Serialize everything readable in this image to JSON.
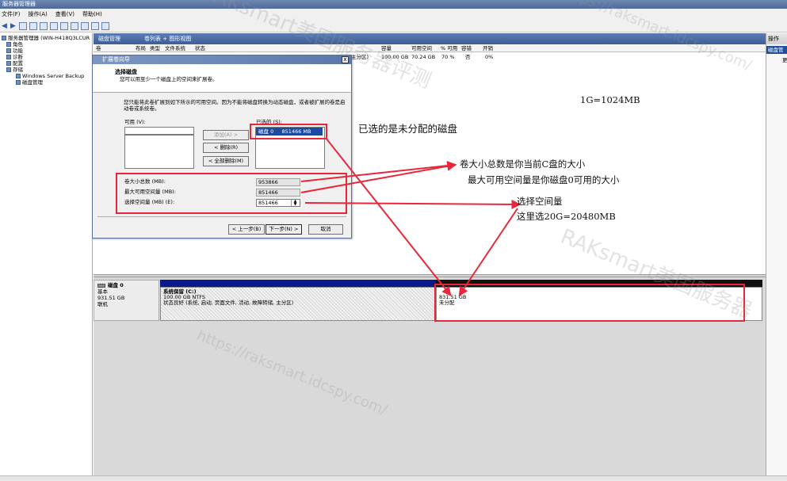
{
  "window": {
    "title": "服务器管理器"
  },
  "menu": [
    "文件(F)",
    "操作(A)",
    "查看(V)",
    "帮助(H)"
  ],
  "tree": {
    "items": [
      "服务器管理器 (WIN-H418Q3LCUR",
      "角色",
      "功能",
      "诊断",
      "配置",
      "存储",
      "Windows Server Backup",
      "磁盘管理"
    ]
  },
  "main": {
    "title": "磁盘管理",
    "view": "卷列表 + 图形视图",
    "columns": [
      "卷",
      "布局",
      "类型",
      "文件系统",
      "状态",
      "容量",
      "可用空间",
      "% 可用",
      "容错",
      "开销"
    ],
    "volume_row": {
      "status": "主分区)",
      "capacity": "100.00 GB",
      "free": "70.24 GB",
      "pct": "70 %",
      "fault": "否",
      "overhead": "0%"
    }
  },
  "actions": {
    "header": "操作",
    "item": "磁盘管",
    "more": "更"
  },
  "disk": {
    "name": "磁盘 0",
    "type": "基本",
    "size": "931.51 GB",
    "state": "联机",
    "partition_c": {
      "name": "系统保留  (C:)",
      "size_fs": "100.00 GB NTFS",
      "status": "状态良好 (系统, 启动, 页面文件, 活动, 故障转储, 主分区)"
    },
    "partition_u": {
      "size": "831.51 GB",
      "status": "未分配"
    }
  },
  "wizard": {
    "title": "扩展卷向导",
    "close": "x",
    "header_title": "选择磁盘",
    "header_sub": "您可以用至少一个磁盘上的空间来扩展卷。",
    "desc": "您只能将此卷扩展到如下所示的可用空间。因为不能将磁盘转换为动态磁盘，或者被扩展的卷是启动卷或系统卷。",
    "available_label": "可用 (V):",
    "selected_label": "已选的 (S):",
    "selected_item": "磁盘 0     851466 MB",
    "add_button": "添加(A) >",
    "remove_button": "< 删除(R)",
    "remove_all_button": "< 全部删除(M)",
    "total_label": "卷大小总数 (MB):",
    "total_value": "953866",
    "max_label": "最大可用空间量 (MB):",
    "max_value": "851466",
    "select_label": "选择空间量 (MB) (E):",
    "select_value": "851466",
    "back_button": "< 上一步(B)",
    "next_button": "下一步(N) >",
    "cancel_button": "取消"
  },
  "annotations": {
    "unit": "1G=1024MB",
    "selected_unallocated": "已选的是未分配的磁盘",
    "total_is_c": "卷大小总数是你当前C盘的大小",
    "max_is_free": "最大可用空间量是你磁盘0可用的大小",
    "choose_amount": "选择空间量",
    "example": "这里选20G=20480MB"
  },
  "watermarks": [
    "RAKsmart美国服务器评测",
    "https://raksmart.idcspy.com/",
    "RAKsmart美国服务器",
    "https://raksmart.idcspy.com/"
  ],
  "colors": {
    "annotation_red": "#e8283a",
    "selected_blue": "#1b4aa0",
    "primary_partition": "#0b1a8a"
  }
}
